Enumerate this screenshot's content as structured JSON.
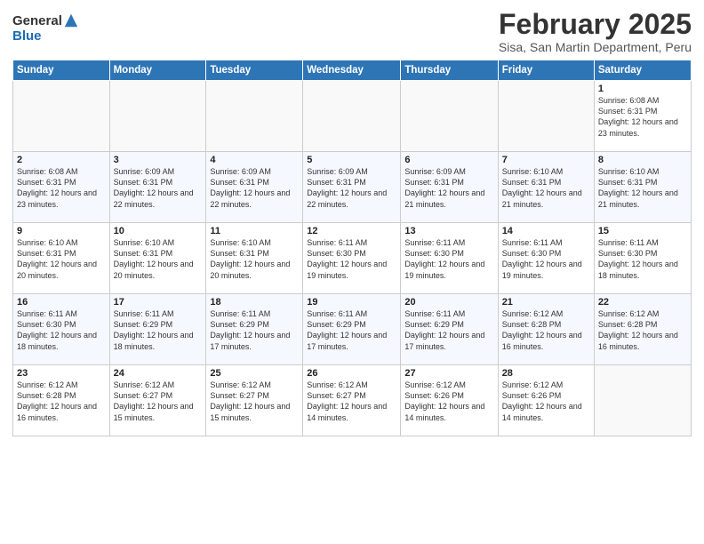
{
  "header": {
    "logo_general": "General",
    "logo_blue": "Blue",
    "title": "February 2025",
    "subtitle": "Sisa, San Martin Department, Peru"
  },
  "days_of_week": [
    "Sunday",
    "Monday",
    "Tuesday",
    "Wednesday",
    "Thursday",
    "Friday",
    "Saturday"
  ],
  "weeks": [
    [
      {
        "day": "",
        "info": ""
      },
      {
        "day": "",
        "info": ""
      },
      {
        "day": "",
        "info": ""
      },
      {
        "day": "",
        "info": ""
      },
      {
        "day": "",
        "info": ""
      },
      {
        "day": "",
        "info": ""
      },
      {
        "day": "1",
        "info": "Sunrise: 6:08 AM\nSunset: 6:31 PM\nDaylight: 12 hours and 23 minutes."
      }
    ],
    [
      {
        "day": "2",
        "info": "Sunrise: 6:08 AM\nSunset: 6:31 PM\nDaylight: 12 hours and 23 minutes."
      },
      {
        "day": "3",
        "info": "Sunrise: 6:09 AM\nSunset: 6:31 PM\nDaylight: 12 hours and 22 minutes."
      },
      {
        "day": "4",
        "info": "Sunrise: 6:09 AM\nSunset: 6:31 PM\nDaylight: 12 hours and 22 minutes."
      },
      {
        "day": "5",
        "info": "Sunrise: 6:09 AM\nSunset: 6:31 PM\nDaylight: 12 hours and 22 minutes."
      },
      {
        "day": "6",
        "info": "Sunrise: 6:09 AM\nSunset: 6:31 PM\nDaylight: 12 hours and 21 minutes."
      },
      {
        "day": "7",
        "info": "Sunrise: 6:10 AM\nSunset: 6:31 PM\nDaylight: 12 hours and 21 minutes."
      },
      {
        "day": "8",
        "info": "Sunrise: 6:10 AM\nSunset: 6:31 PM\nDaylight: 12 hours and 21 minutes."
      }
    ],
    [
      {
        "day": "9",
        "info": "Sunrise: 6:10 AM\nSunset: 6:31 PM\nDaylight: 12 hours and 20 minutes."
      },
      {
        "day": "10",
        "info": "Sunrise: 6:10 AM\nSunset: 6:31 PM\nDaylight: 12 hours and 20 minutes."
      },
      {
        "day": "11",
        "info": "Sunrise: 6:10 AM\nSunset: 6:31 PM\nDaylight: 12 hours and 20 minutes."
      },
      {
        "day": "12",
        "info": "Sunrise: 6:11 AM\nSunset: 6:30 PM\nDaylight: 12 hours and 19 minutes."
      },
      {
        "day": "13",
        "info": "Sunrise: 6:11 AM\nSunset: 6:30 PM\nDaylight: 12 hours and 19 minutes."
      },
      {
        "day": "14",
        "info": "Sunrise: 6:11 AM\nSunset: 6:30 PM\nDaylight: 12 hours and 19 minutes."
      },
      {
        "day": "15",
        "info": "Sunrise: 6:11 AM\nSunset: 6:30 PM\nDaylight: 12 hours and 18 minutes."
      }
    ],
    [
      {
        "day": "16",
        "info": "Sunrise: 6:11 AM\nSunset: 6:30 PM\nDaylight: 12 hours and 18 minutes."
      },
      {
        "day": "17",
        "info": "Sunrise: 6:11 AM\nSunset: 6:29 PM\nDaylight: 12 hours and 18 minutes."
      },
      {
        "day": "18",
        "info": "Sunrise: 6:11 AM\nSunset: 6:29 PM\nDaylight: 12 hours and 17 minutes."
      },
      {
        "day": "19",
        "info": "Sunrise: 6:11 AM\nSunset: 6:29 PM\nDaylight: 12 hours and 17 minutes."
      },
      {
        "day": "20",
        "info": "Sunrise: 6:11 AM\nSunset: 6:29 PM\nDaylight: 12 hours and 17 minutes."
      },
      {
        "day": "21",
        "info": "Sunrise: 6:12 AM\nSunset: 6:28 PM\nDaylight: 12 hours and 16 minutes."
      },
      {
        "day": "22",
        "info": "Sunrise: 6:12 AM\nSunset: 6:28 PM\nDaylight: 12 hours and 16 minutes."
      }
    ],
    [
      {
        "day": "23",
        "info": "Sunrise: 6:12 AM\nSunset: 6:28 PM\nDaylight: 12 hours and 16 minutes."
      },
      {
        "day": "24",
        "info": "Sunrise: 6:12 AM\nSunset: 6:27 PM\nDaylight: 12 hours and 15 minutes."
      },
      {
        "day": "25",
        "info": "Sunrise: 6:12 AM\nSunset: 6:27 PM\nDaylight: 12 hours and 15 minutes."
      },
      {
        "day": "26",
        "info": "Sunrise: 6:12 AM\nSunset: 6:27 PM\nDaylight: 12 hours and 14 minutes."
      },
      {
        "day": "27",
        "info": "Sunrise: 6:12 AM\nSunset: 6:26 PM\nDaylight: 12 hours and 14 minutes."
      },
      {
        "day": "28",
        "info": "Sunrise: 6:12 AM\nSunset: 6:26 PM\nDaylight: 12 hours and 14 minutes."
      },
      {
        "day": "",
        "info": ""
      }
    ]
  ]
}
